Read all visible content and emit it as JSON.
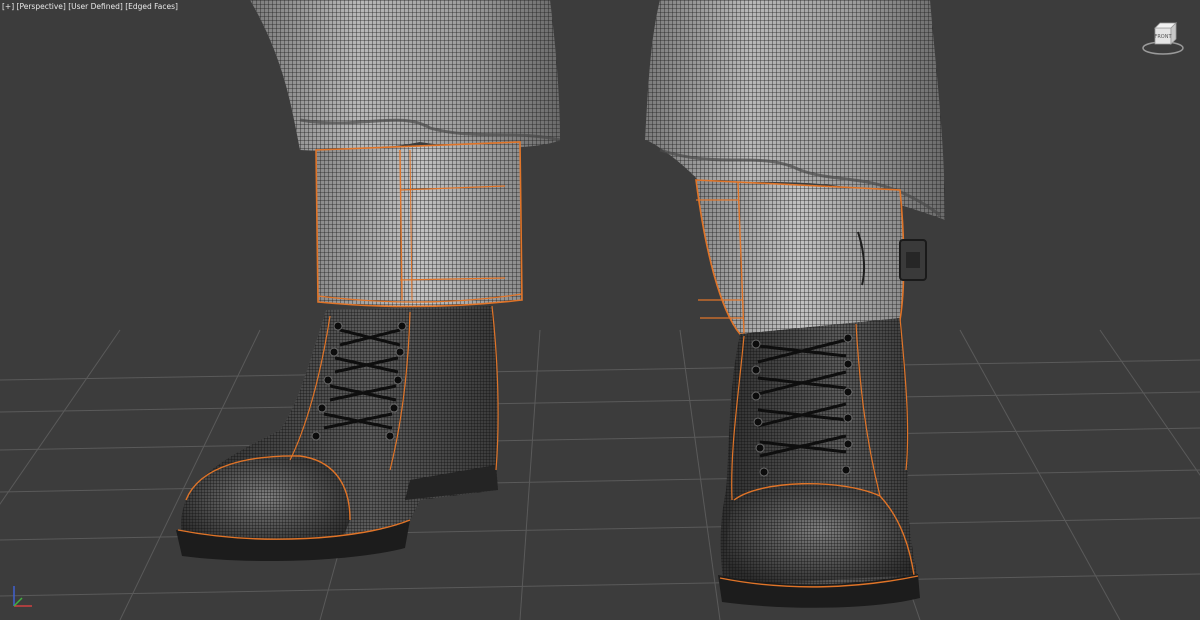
{
  "viewport": {
    "labels": {
      "menu": "[+]",
      "view": "[Perspective]",
      "shading_mode": "[User Defined]",
      "display_mode": "[Edged Faces]"
    },
    "viewcube": {
      "face_label": "FRONT"
    },
    "axis_tripod": {
      "axes": [
        "x",
        "y",
        "z"
      ]
    }
  },
  "colors": {
    "background": "#3c3c3c",
    "grid": "#5a5a5a",
    "wire": "#1e1e1e",
    "edge_highlight": "#e07428",
    "boot": "#3a3a3a",
    "trouser": "#9a9a9a"
  },
  "icons": {
    "viewcube": "viewcube-icon",
    "axis": "axis-tripod-icon"
  }
}
